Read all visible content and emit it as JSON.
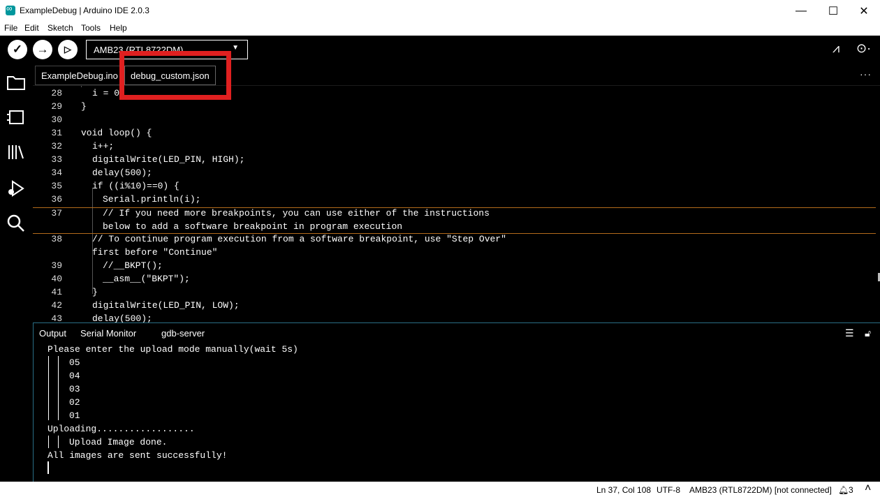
{
  "window": {
    "title": "ExampleDebug | Arduino IDE 2.0.3"
  },
  "menu": [
    "File",
    "Edit",
    "Sketch",
    "Tools",
    "Help"
  ],
  "toolbar": {
    "board_selected": "AMB23 (RTL8722DM)"
  },
  "tabs": [
    {
      "label": "ExampleDebug.ino",
      "active": false
    },
    {
      "label": "debug_custom.json",
      "active": true
    }
  ],
  "editor": {
    "lines": [
      {
        "num": "28",
        "code": "i = 0"
      },
      {
        "num": "29",
        "code": "}"
      },
      {
        "num": "30",
        "code": ""
      },
      {
        "num": "31",
        "code": "void loop() {"
      },
      {
        "num": "32",
        "code": "i++;"
      },
      {
        "num": "33",
        "code": "digitalWrite(LED_PIN, HIGH);"
      },
      {
        "num": "34",
        "code": "delay(500);"
      },
      {
        "num": "35",
        "code": "if ((i%10)==0) {"
      },
      {
        "num": "36",
        "code": "Serial.println(i);"
      },
      {
        "num": "37",
        "code": "// If you need more breakpoints, you can use either of the instructions"
      },
      {
        "num": "",
        "code": "below to add a software breakpoint in program execution"
      },
      {
        "num": "38",
        "code": "// To continue program execution from a software breakpoint, use \"Step Over\""
      },
      {
        "num": "",
        "code": "first before \"Continue\""
      },
      {
        "num": "39",
        "code": "//__BKPT();"
      },
      {
        "num": "40",
        "code": "__asm__(\"BKPT\");"
      },
      {
        "num": "41",
        "code": "}"
      },
      {
        "num": "42",
        "code": "digitalWrite(LED_PIN, LOW);"
      },
      {
        "num": "43",
        "code": "delay(500);"
      }
    ]
  },
  "panel": {
    "tabs": [
      "Output",
      "Serial Monitor",
      "gdb-server"
    ],
    "output_lines": [
      "Please enter the upload mode manually(wait 5s)",
      "05",
      "04",
      "03",
      "02",
      "01",
      "Uploading..................",
      "Upload Image done.",
      "All images are sent successfully!"
    ]
  },
  "status": {
    "position": "Ln 37, Col 108",
    "encoding": "UTF-8",
    "board": "AMB23 (RTL8722DM) [not connected]",
    "notifications": "3"
  },
  "colors": {
    "highlight_box": "#e02020",
    "accent": "#2a6f86"
  }
}
